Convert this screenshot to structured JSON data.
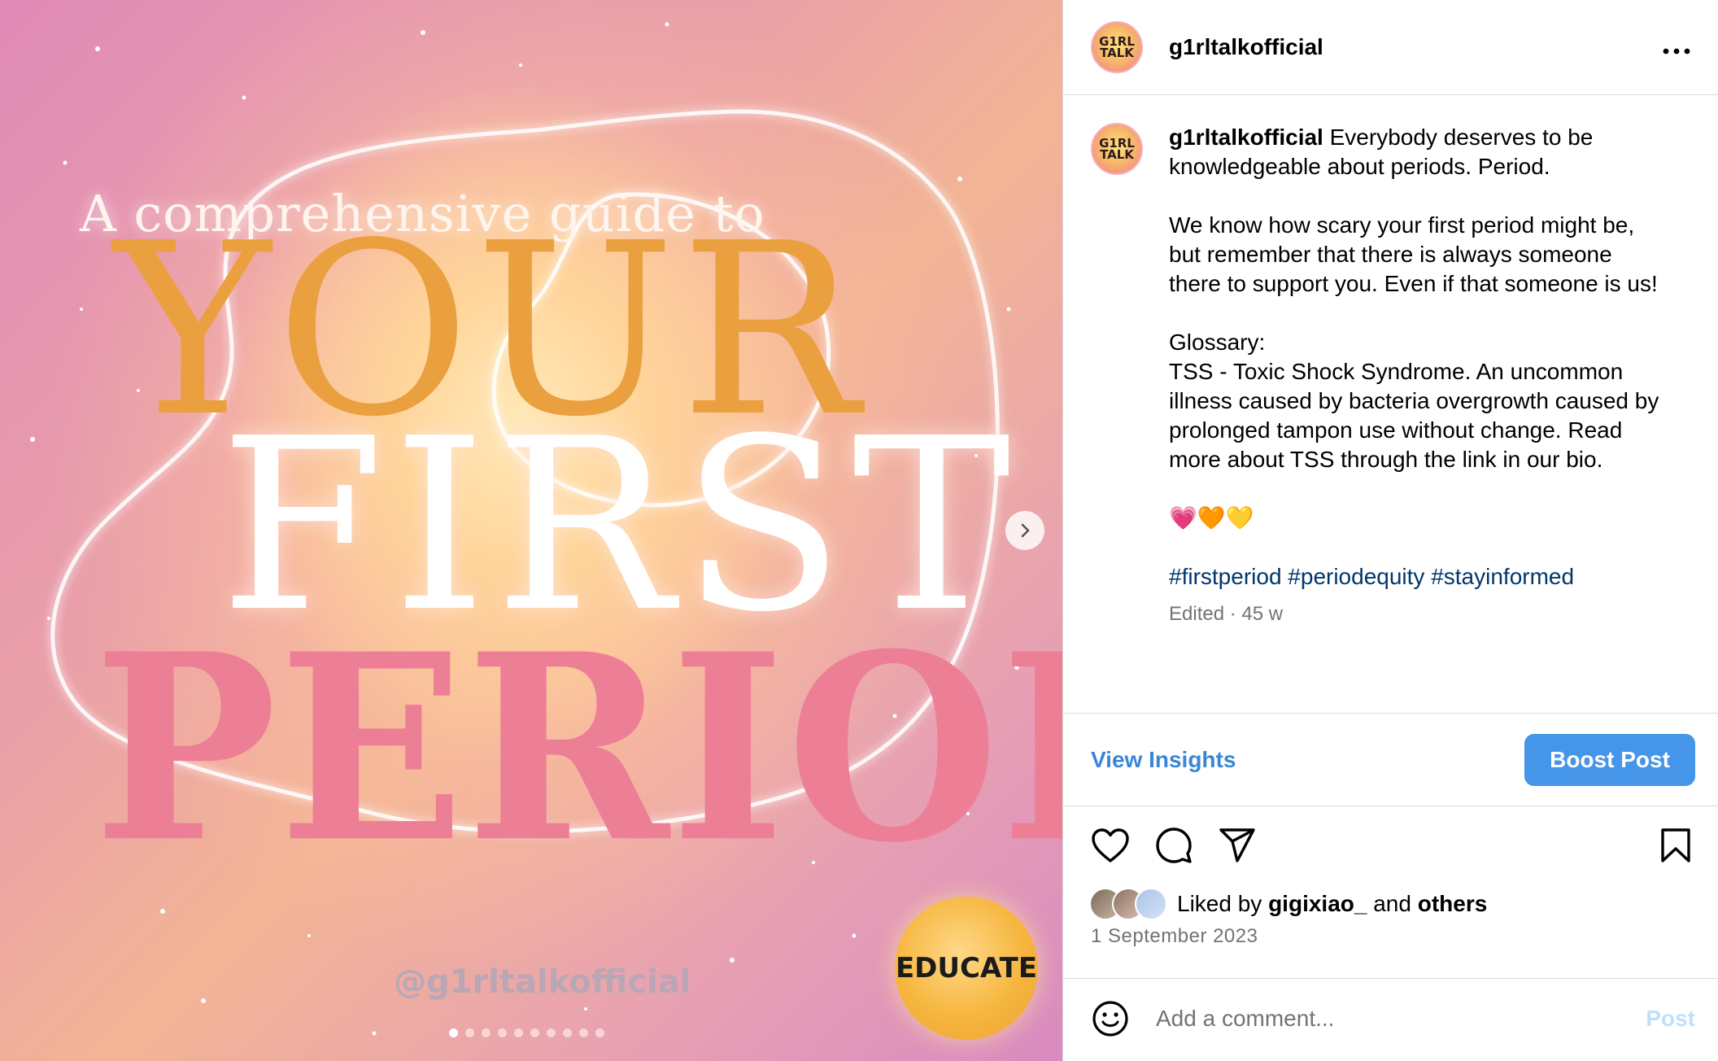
{
  "media": {
    "subtitle": "A comprehensive guide to",
    "line1": "YOUR",
    "line2": "FIRST",
    "line3": "PERIOD.",
    "watermark": "@g1rltalkofficial",
    "badge": "EDUCATE",
    "slide_count": 10,
    "active_slide": 1,
    "colors": {
      "your": "#eba040",
      "first": "#ffffff",
      "period": "#ec7f95"
    }
  },
  "account": {
    "avatar_text_top": "G1RL",
    "avatar_text_bottom": "TALK",
    "username": "g1rltalkofficial"
  },
  "caption": {
    "username": "g1rltalkofficial",
    "line1": "Everybody deserves to be knowledgeable about periods. Period.",
    "para2": "We know how scary your first period might be, but remember that there is always someone there to support you. Even if that someone is us!",
    "glossary_heading": "Glossary:",
    "glossary_body": "TSS - Toxic Shock Syndrome. An uncommon illness caused by bacteria overgrowth caused by prolonged tampon use without change. Read more about TSS through the link in our bio.",
    "emojis": "💗🧡💛",
    "hashtags": [
      "#firstperiod",
      "#periodequity",
      "#stayinformed"
    ],
    "edited": "Edited · 45 w"
  },
  "insights": {
    "view_label": "View Insights",
    "boost_label": "Boost Post"
  },
  "likes": {
    "prefix": "Liked by",
    "user": "gigixiao_",
    "middle": "and",
    "suffix": "others"
  },
  "date": "1 September 2023",
  "comment": {
    "placeholder": "Add a comment...",
    "post_label": "Post"
  }
}
